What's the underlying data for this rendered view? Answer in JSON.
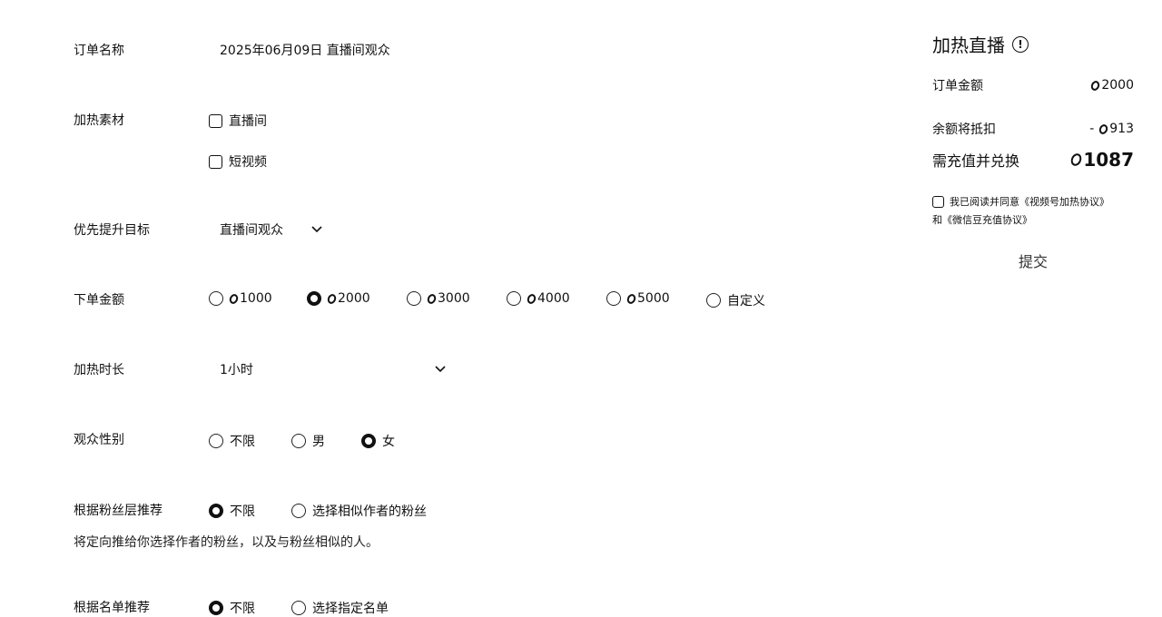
{
  "form": {
    "order_name": {
      "label": "订单名称",
      "value": "2025年06月09日 直播间观众"
    },
    "material": {
      "label": "加热素材",
      "options": [
        {
          "label": "直播间",
          "checked": false
        },
        {
          "label": "短视频",
          "checked": false
        }
      ]
    },
    "goal": {
      "label": "优先提升目标",
      "value": "直播间观众",
      "icon": "chevron-down-icon"
    },
    "amount": {
      "label": "下单金额",
      "options": [
        "1000",
        "2000",
        "3000",
        "4000",
        "5000",
        "自定义"
      ],
      "selected": "2000",
      "currency_icon": "coin-icon"
    },
    "duration": {
      "label": "加热时长",
      "value": "1小时",
      "icon": "chevron-down-icon"
    },
    "gender": {
      "label": "观众性别",
      "options": [
        "不限",
        "男",
        "女"
      ],
      "selected": "女"
    },
    "fans": {
      "label": "根据粉丝层推荐",
      "options": [
        "不限",
        "选择相似作者的粉丝"
      ],
      "selected": "不限",
      "hint": "将定向推给你选择作者的粉丝，以及与粉丝相似的人。"
    },
    "list": {
      "label": "根据名单推荐",
      "options": [
        "不限",
        "选择指定名单"
      ],
      "selected": "不限"
    }
  },
  "panel": {
    "title": "加热直播",
    "info_icon_glyph": "!",
    "order_amount": {
      "label": "订单金额",
      "value": "2000"
    },
    "balance_deduct": {
      "label": "余额将抵扣",
      "prefix": "-",
      "value": "913"
    },
    "recharge": {
      "label": "需充值并兑换",
      "value": "1087"
    },
    "agreement": {
      "line1": "我已阅读并同意《视频号加热协议》",
      "line2": "和《微信豆充值协议》"
    },
    "submit_label": "提交"
  }
}
